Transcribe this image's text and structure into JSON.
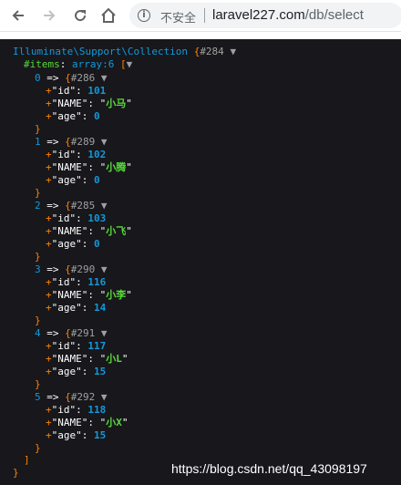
{
  "browser": {
    "security_label": "不安全",
    "url_host": "laravel227.com",
    "url_path": "/db/select"
  },
  "dump": {
    "class_name": "Illuminate\\Support\\Collection",
    "object_id": "#284",
    "items_key": "#items",
    "items_type": "array:6",
    "items": [
      {
        "index": "0",
        "object_id": "#286",
        "id": "101",
        "name": "小马",
        "age": "0"
      },
      {
        "index": "1",
        "object_id": "#289",
        "id": "102",
        "name": "小腾",
        "age": "0"
      },
      {
        "index": "2",
        "object_id": "#285",
        "id": "103",
        "name": "小飞",
        "age": "0"
      },
      {
        "index": "3",
        "object_id": "#290",
        "id": "116",
        "name": "小李",
        "age": "14"
      },
      {
        "index": "4",
        "object_id": "#291",
        "id": "117",
        "name": "小L",
        "age": "15"
      },
      {
        "index": "5",
        "object_id": "#292",
        "id": "118",
        "name": "小X",
        "age": "15"
      }
    ],
    "prop_labels": {
      "id": "id",
      "name": "NAME",
      "age": "age"
    },
    "close_bracket": "]",
    "close_brace": "}"
  },
  "watermark": "https://blog.csdn.net/qq_43098197",
  "colors": {
    "background": "#18171B",
    "class": "#1299DA",
    "brace": "#FF8400",
    "string": "#56DB3A",
    "number": "#1299DA"
  }
}
